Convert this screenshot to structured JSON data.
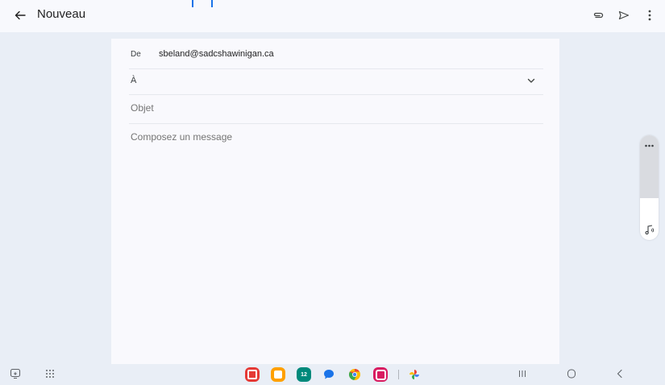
{
  "appbar": {
    "title": "Nouveau",
    "icons": [
      "back-arrow-icon",
      "attach-icon",
      "send-icon",
      "more-vert-icon"
    ]
  },
  "compose": {
    "from_label": "De",
    "from_value": "sbeland@sadcshawinigan.ca",
    "to_label": "À",
    "subject_placeholder": "Objet",
    "body_placeholder": "Composez un message"
  },
  "calendar_day": "12",
  "taskbar": {
    "apps": [
      "flipboard-app",
      "notes-app",
      "calendar-app",
      "messages-app",
      "chrome-app",
      "screen-recorder-app",
      "photos-app"
    ],
    "nav": [
      "recents-button",
      "home-button",
      "back-button"
    ]
  },
  "colors": {
    "background": "#e9eef6",
    "card": "#f9f9fd",
    "accent": "#1a73e8"
  }
}
